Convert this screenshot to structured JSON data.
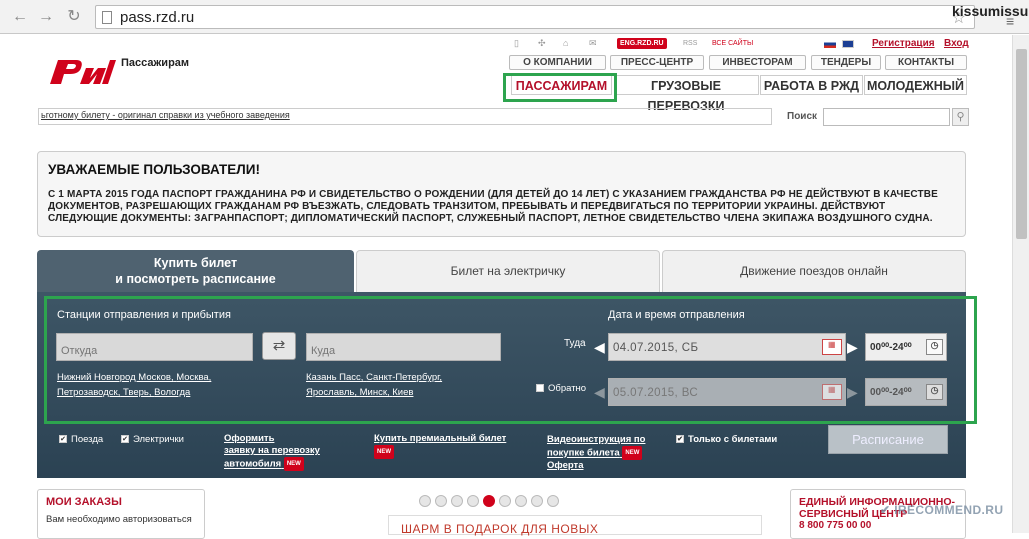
{
  "browser": {
    "url": "pass.rzd.ru",
    "user": "kissumissu"
  },
  "header": {
    "brand": "Пассажирам",
    "eng_badge": "ENG.RZD.RU",
    "rss": "RSS",
    "all_sites": "ВСЕ САЙТЫ",
    "register": "Регистрация",
    "login": "Вход",
    "top_menu": [
      "О КОМПАНИИ",
      "ПРЕСС-ЦЕНТР",
      "ИНВЕСТОРАМ",
      "ТЕНДЕРЫ",
      "КОНТАКТЫ"
    ],
    "main_menu": [
      "ПАССАЖИРАМ",
      "ГРУЗОВЫЕ ПЕРЕВОЗКИ",
      "РАБОТА В РЖД",
      "МОЛОДЕЖНЫЙ"
    ]
  },
  "ticker": "ьготному билету - оригинал справки из учебного заведения",
  "search": {
    "label": "Поиск",
    "placeholder": ""
  },
  "notice": {
    "title": "УВАЖАЕМЫЕ ПОЛЬЗОВАТЕЛИ!",
    "text": "С 1 МАРТА 2015 ГОДА ПАСПОРТ ГРАЖДАНИНА РФ И СВИДЕТЕЛЬСТВО О РОЖДЕНИИ (ДЛЯ ДЕТЕЙ ДО 14 ЛЕТ) С УКАЗАНИЕМ ГРАЖДАНСТВА РФ НЕ ДЕЙСТВУЮТ В КАЧЕСТВЕ ДОКУМЕНТОВ, РАЗРЕШАЮЩИХ ГРАЖДАНАМ РФ ВЪЕЗЖАТЬ, СЛЕДОВАТЬ ТРАНЗИТОМ, ПРЕБЫВАТЬ И ПЕРЕДВИГАТЬСЯ ПО ТЕРРИТОРИИ УКРАИНЫ. ДЕЙСТВУЮТ СЛЕДУЮЩИЕ ДОКУМЕНТЫ: ЗАГРАНПАСПОРТ; ДИПЛОМАТИЧЕСКИЙ ПАСПОРТ, СЛУЖЕБНЫЙ ПАСПОРТ, ЛЕТНОЕ СВИДЕТЕЛЬСТВО ЧЛЕНА ЭКИПАЖА ВОЗДУШНОГО СУДНА."
  },
  "tabs": {
    "buy_line1": "Купить билет",
    "buy_line2": "и посмотреть расписание",
    "commuter": "Билет на электричку",
    "online": "Движение поездов онлайн"
  },
  "form": {
    "stations_label": "Станции отправления и прибытия",
    "from_placeholder": "Откуда",
    "to_placeholder": "Куда",
    "from_quick": [
      "Нижний Новгород Москов,",
      "Москва,",
      "Петрозаводск,",
      "Тверь,",
      "Вологда"
    ],
    "to_quick": [
      "Казань Пасс,",
      "Санкт-Петербург,",
      "Ярославль,",
      "Минск,",
      "Киев"
    ],
    "date_label": "Дата и время отправления",
    "there_label": "Туда",
    "there_date": "04.07.2015, СБ",
    "back_label": "Обратно",
    "back_date": "05.07.2015, ВС",
    "time_there": "00⁰⁰-24⁰⁰",
    "time_back": "00⁰⁰-24⁰⁰"
  },
  "options": {
    "trains": "Поезда",
    "commuters": "Электрички",
    "car_line1": "Оформить",
    "car_line2": "заявку на перевозку",
    "car_line3": "автомобиля",
    "premium": "Купить премиальный билет",
    "video_line1": "Видеоинструкция по",
    "video_line2": "покупке билета",
    "video_line3": "Оферта",
    "only_tickets": "Только с билетами",
    "new_badge": "NEW",
    "schedule_button": "Расписание"
  },
  "orders": {
    "title": "МОИ ЗАКАЗЫ",
    "text": "Вам необходимо авторизоваться"
  },
  "promo": "ШАРМ В ПОДАРОК ДЛЯ НОВЫХ",
  "info": {
    "title_line1": "ЕДИНЫЙ ИНФОРМАЦИОННО-",
    "title_line2": "СЕРВИСНЫЙ ЦЕНТР",
    "phone": "8 800 775 00 00"
  },
  "watermark": "✔ IRECOMMEND.RU",
  "colors": {
    "brand_red": "#d0021b",
    "panel": "#2f4a5c",
    "highlight_green": "#2da44e"
  }
}
